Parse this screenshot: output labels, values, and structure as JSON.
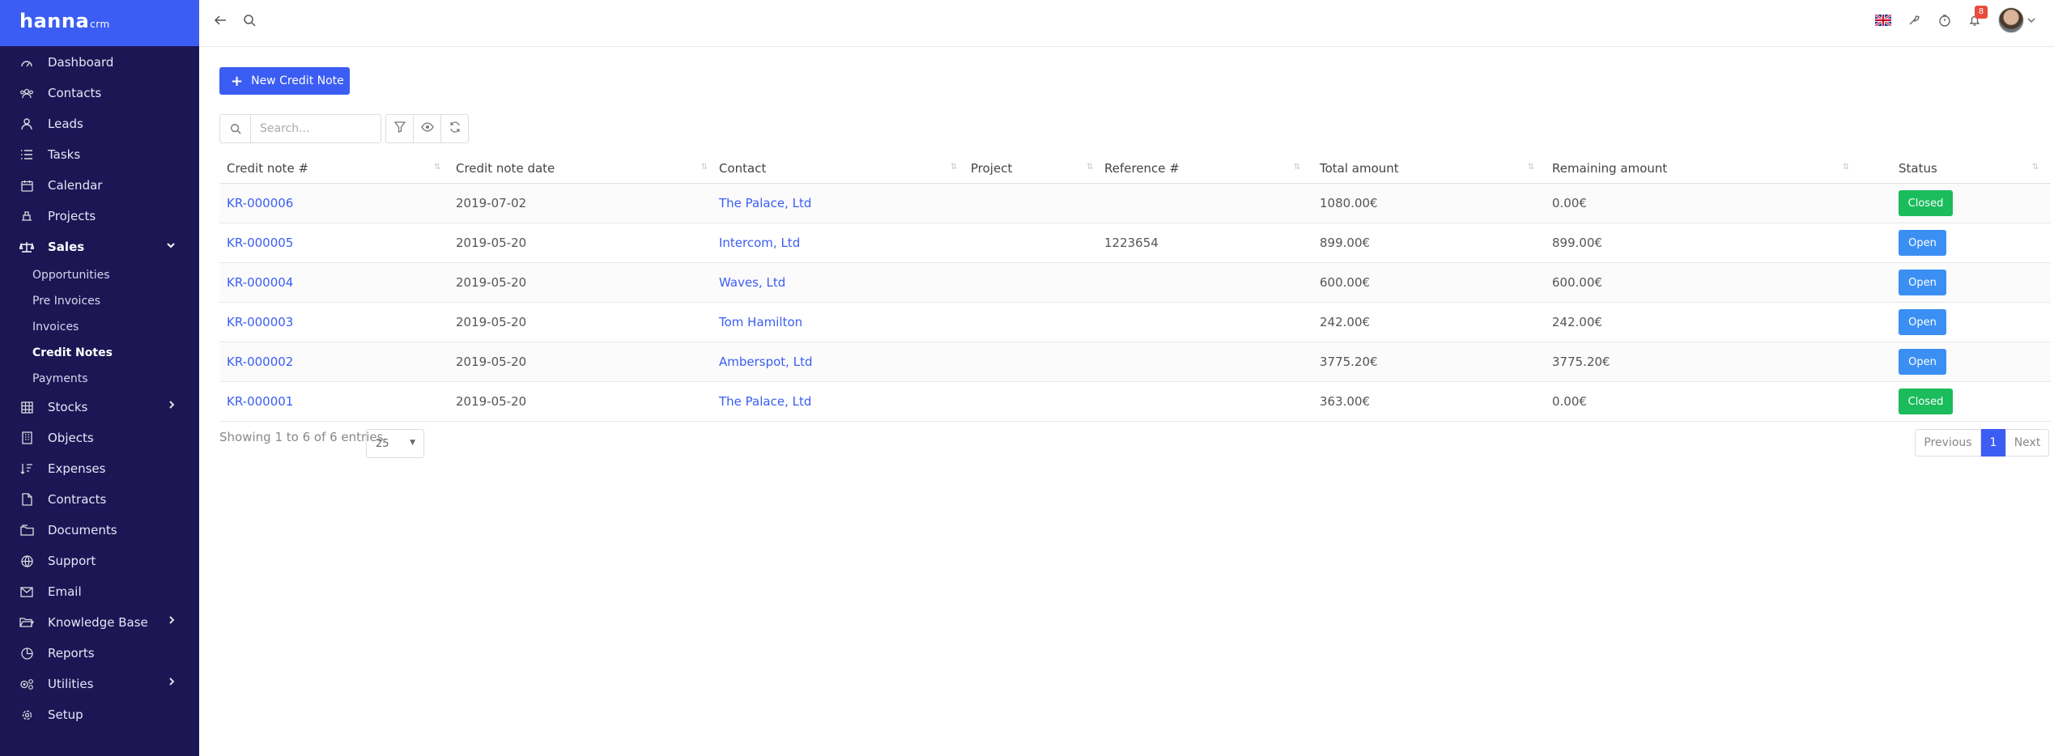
{
  "app": {
    "logo_main": "hanna",
    "logo_sub": "crm"
  },
  "sidebar": {
    "items": [
      {
        "label": "Dashboard",
        "icon": "dashboard-icon"
      },
      {
        "label": "Contacts",
        "icon": "contacts-icon"
      },
      {
        "label": "Leads",
        "icon": "leads-icon"
      },
      {
        "label": "Tasks",
        "icon": "tasks-icon"
      },
      {
        "label": "Calendar",
        "icon": "calendar-icon"
      },
      {
        "label": "Projects",
        "icon": "projects-icon"
      },
      {
        "label": "Sales",
        "icon": "sales-icon",
        "expanded": true
      },
      {
        "label": "Stocks",
        "icon": "stocks-icon"
      },
      {
        "label": "Objects",
        "icon": "objects-icon"
      },
      {
        "label": "Expenses",
        "icon": "expenses-icon"
      },
      {
        "label": "Contracts",
        "icon": "contracts-icon"
      },
      {
        "label": "Documents",
        "icon": "documents-icon"
      },
      {
        "label": "Support",
        "icon": "support-icon"
      },
      {
        "label": "Email",
        "icon": "email-icon"
      },
      {
        "label": "Knowledge Base",
        "icon": "knowledge-base-icon"
      },
      {
        "label": "Reports",
        "icon": "reports-icon"
      },
      {
        "label": "Utilities",
        "icon": "utilities-icon"
      },
      {
        "label": "Setup",
        "icon": "setup-icon"
      }
    ],
    "sales_sub": [
      "Opportunities",
      "Pre Invoices",
      "Invoices",
      "Credit Notes",
      "Payments"
    ],
    "active_sub": "Credit Notes"
  },
  "topbar": {
    "notification_count": "8"
  },
  "toolbar": {
    "new_label": "New Credit Note",
    "search_placeholder": "Search..."
  },
  "table": {
    "headers": [
      "Credit note #",
      "Credit note date",
      "Contact",
      "Project",
      "Reference #",
      "Total amount",
      "Remaining amount",
      "Status"
    ],
    "rows": [
      {
        "number": "KR-000006",
        "date": "2019-07-02",
        "contact": "The Palace, Ltd",
        "project": "",
        "reference": "",
        "total": "1080.00€",
        "remaining": "0.00€",
        "status": "Closed"
      },
      {
        "number": "KR-000005",
        "date": "2019-05-20",
        "contact": "Intercom, Ltd",
        "project": "",
        "reference": "1223654",
        "total": "899.00€",
        "remaining": "899.00€",
        "status": "Open"
      },
      {
        "number": "KR-000004",
        "date": "2019-05-20",
        "contact": "Waves, Ltd",
        "project": "",
        "reference": "",
        "total": "600.00€",
        "remaining": "600.00€",
        "status": "Open"
      },
      {
        "number": "KR-000003",
        "date": "2019-05-20",
        "contact": "Tom Hamilton",
        "project": "",
        "reference": "",
        "total": "242.00€",
        "remaining": "242.00€",
        "status": "Open"
      },
      {
        "number": "KR-000002",
        "date": "2019-05-20",
        "contact": "Amberspot, Ltd",
        "project": "",
        "reference": "",
        "total": "3775.20€",
        "remaining": "3775.20€",
        "status": "Open"
      },
      {
        "number": "KR-000001",
        "date": "2019-05-20",
        "contact": "The Palace, Ltd",
        "project": "",
        "reference": "",
        "total": "363.00€",
        "remaining": "0.00€",
        "status": "Closed"
      }
    ]
  },
  "footer": {
    "info": "Showing 1 to 6 of 6 entries",
    "page_length": "25",
    "prev_label": "Previous",
    "current_page": "1",
    "next_label": "Next"
  },
  "colors": {
    "primary": "#3b5df3",
    "sidebar": "#1c1655",
    "closed": "#1abc5c",
    "open": "#3b8ff3",
    "badge": "#e84c3d"
  }
}
